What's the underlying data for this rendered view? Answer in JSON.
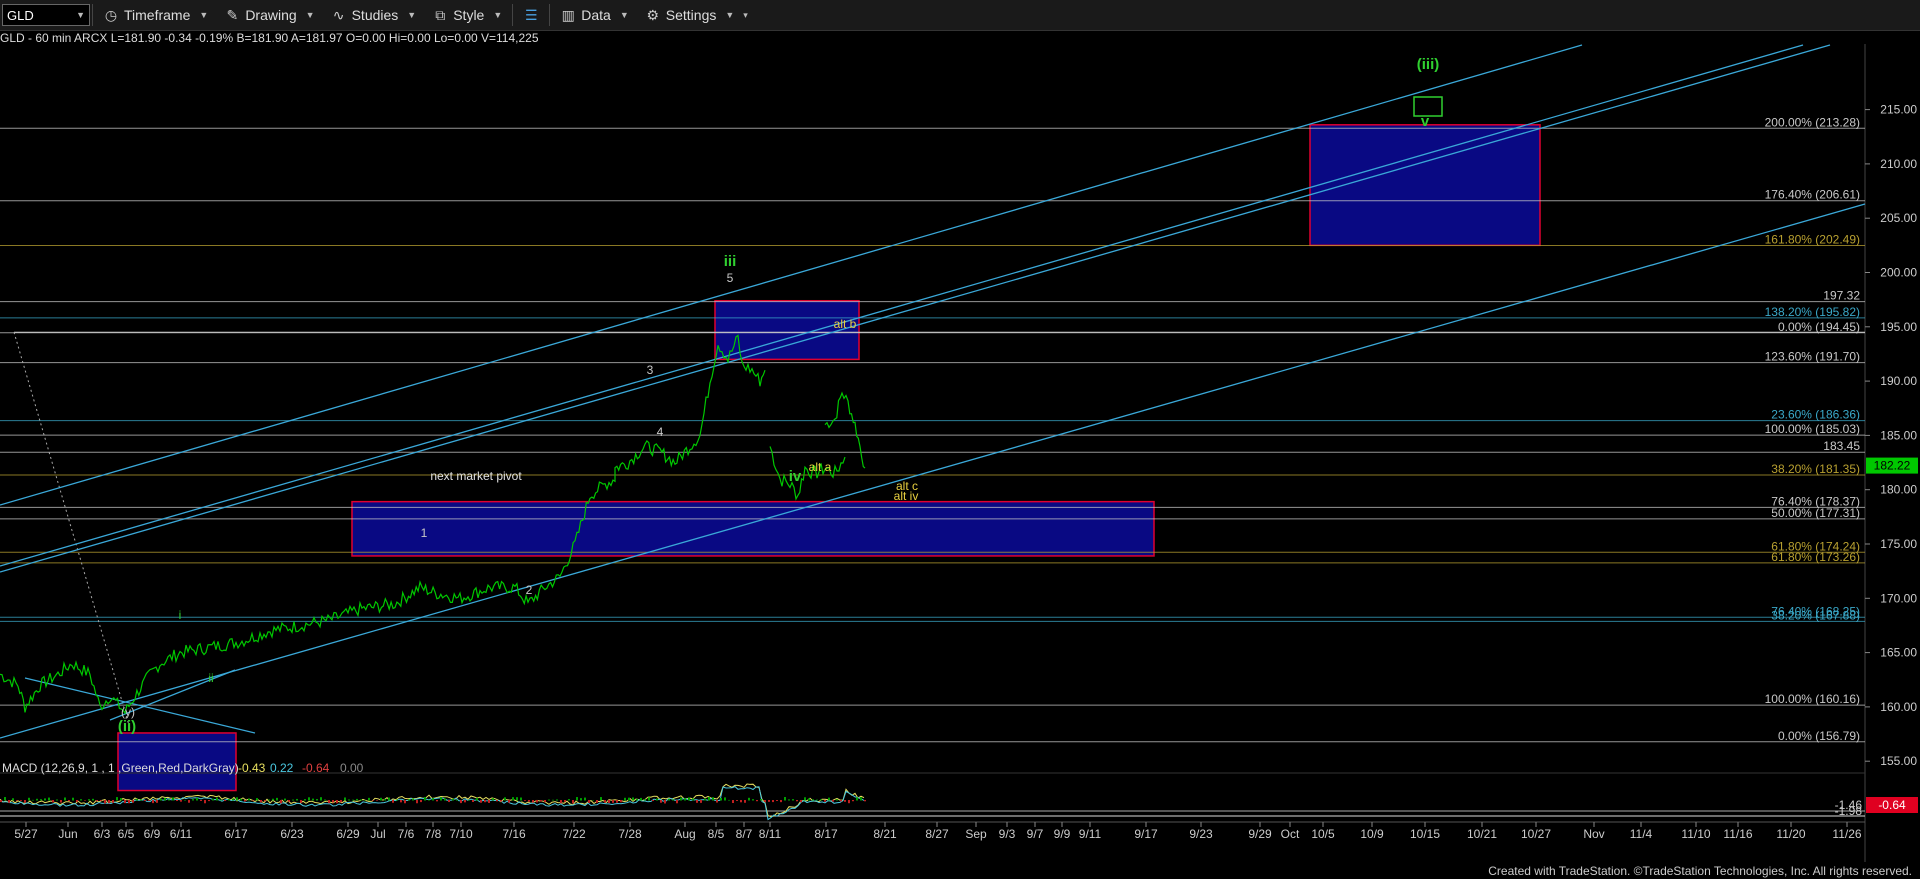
{
  "toolbar": {
    "symbol": "GLD",
    "timeframe": "Timeframe",
    "drawing": "Drawing",
    "studies": "Studies",
    "style": "Style",
    "data": "Data",
    "settings": "Settings"
  },
  "info_line": "GLD - 60 min  ARCX  L=181.90 -0.34 -0.19% B=181.90 A=181.97 O=0.00 Hi=0.00 Lo=0.00 V=114,225",
  "colors": {
    "background": "#000000",
    "price_up": "#00c800",
    "box_fill": "#00008b",
    "box_border": "#e00030",
    "channel": "#3aa8d8"
  },
  "chart_data": {
    "type": "line",
    "ylim": [
      150,
      217
    ],
    "y_ticks": [
      "155.00",
      "160.00",
      "165.00",
      "170.00",
      "175.00",
      "180.00",
      "185.00",
      "190.00",
      "195.00",
      "200.00",
      "205.00",
      "210.00",
      "215.00"
    ],
    "x_ticks": [
      "5/27",
      "Jun",
      "6/3",
      "6/5",
      "6/9",
      "6/11",
      "6/17",
      "6/23",
      "6/29",
      "Jul",
      "7/6",
      "7/8",
      "7/10",
      "7/16",
      "7/22",
      "7/28",
      "Aug",
      "8/5",
      "8/7",
      "8/11",
      "8/17",
      "8/21",
      "8/27",
      "Sep",
      "9/3",
      "9/7",
      "9/9",
      "9/11",
      "9/17",
      "9/23",
      "9/29",
      "Oct",
      "10/5",
      "10/9",
      "10/15",
      "10/21",
      "10/27",
      "Nov",
      "11/4",
      "11/10",
      "11/16",
      "11/20",
      "11/26"
    ],
    "last_price": "182.22",
    "fib_levels": [
      {
        "label": "200.00% (213.28)",
        "value": 213.28,
        "color": "#c8c8c8"
      },
      {
        "label": "176.40% (206.61)",
        "value": 206.61,
        "color": "#c8c8c8"
      },
      {
        "label": "161.80% (202.49)",
        "value": 202.49,
        "color": "#b8a030"
      },
      {
        "label": "197.32",
        "value": 197.32,
        "color": "#c8c8c8"
      },
      {
        "label": "138.20% (195.82)",
        "value": 195.82,
        "color": "#3aa8c8"
      },
      {
        "label": "0.00% (194.45)",
        "value": 194.45,
        "color": "#c8c8c8"
      },
      {
        "label": "123.60% (191.70)",
        "value": 191.7,
        "color": "#c8c8c8"
      },
      {
        "label": "23.60% (186.36)",
        "value": 186.36,
        "color": "#3aa8c8"
      },
      {
        "label": "100.00% (185.03)",
        "value": 185.03,
        "color": "#c8c8c8"
      },
      {
        "label": "183.45",
        "value": 183.45,
        "color": "#c8c8c8"
      },
      {
        "label": "38.20% (181.35)",
        "value": 181.35,
        "color": "#b8a030"
      },
      {
        "label": "76.40% (178.37)",
        "value": 178.37,
        "color": "#c8c8c8"
      },
      {
        "label": "50.00% (177.31)",
        "value": 177.31,
        "color": "#c8c8c8"
      },
      {
        "label": "61.80% (174.24)",
        "value": 174.24,
        "color": "#b8a030"
      },
      {
        "label": "61.80% (173.26)",
        "value": 173.26,
        "color": "#b8a030"
      },
      {
        "label": "76.40% (168.25)",
        "value": 168.25,
        "color": "#3aa8c8"
      },
      {
        "label": "38.20% (167.88)",
        "value": 167.88,
        "color": "#3aa8c8"
      },
      {
        "label": "100.00% (160.16)",
        "value": 160.16,
        "color": "#c8c8c8"
      },
      {
        "label": "0.00% (156.79)",
        "value": 156.79,
        "color": "#c8c8c8"
      }
    ],
    "wave_labels": [
      {
        "text": "(iii)",
        "color": "#30d030",
        "bold": true,
        "boxed": true
      },
      {
        "text": "v",
        "color": "#30d030",
        "bold": true
      },
      {
        "text": "iii",
        "color": "#30d030",
        "bold": true
      },
      {
        "text": "5",
        "color": "#c8c8c8"
      },
      {
        "text": "alt b",
        "color": "#e8d040"
      },
      {
        "text": "3",
        "color": "#c8c8c8"
      },
      {
        "text": "4",
        "color": "#c8c8c8"
      },
      {
        "text": "next market pivot",
        "color": "#e0e0e0"
      },
      {
        "text": "alt a",
        "color": "#e8d040"
      },
      {
        "text": "iv",
        "color": "#30d030",
        "bold": true
      },
      {
        "text": "alt c",
        "color": "#e8d040"
      },
      {
        "text": "alt iv",
        "color": "#e8d040"
      },
      {
        "text": "1",
        "color": "#c8c8c8"
      },
      {
        "text": "2",
        "color": "#c8c8c8"
      },
      {
        "text": "i",
        "color": "#30d030"
      },
      {
        "text": "ii",
        "color": "#30d030"
      },
      {
        "text": "(y)",
        "color": "#c8c8c8"
      },
      {
        "text": "(ii)",
        "color": "#30d030",
        "bold": true
      }
    ],
    "macd": {
      "label": "MACD (12,26,9, 1 , 1 ,Green,Red,DarkGray)",
      "values": [
        "-0.43",
        "0.22",
        "-0.64",
        "0.00"
      ],
      "axis_labels": [
        "-1.46",
        "-1.98"
      ],
      "badge": "-0.64"
    }
  },
  "footer": "Created with TradeStation. ©TradeStation Technologies, Inc. All rights reserved."
}
